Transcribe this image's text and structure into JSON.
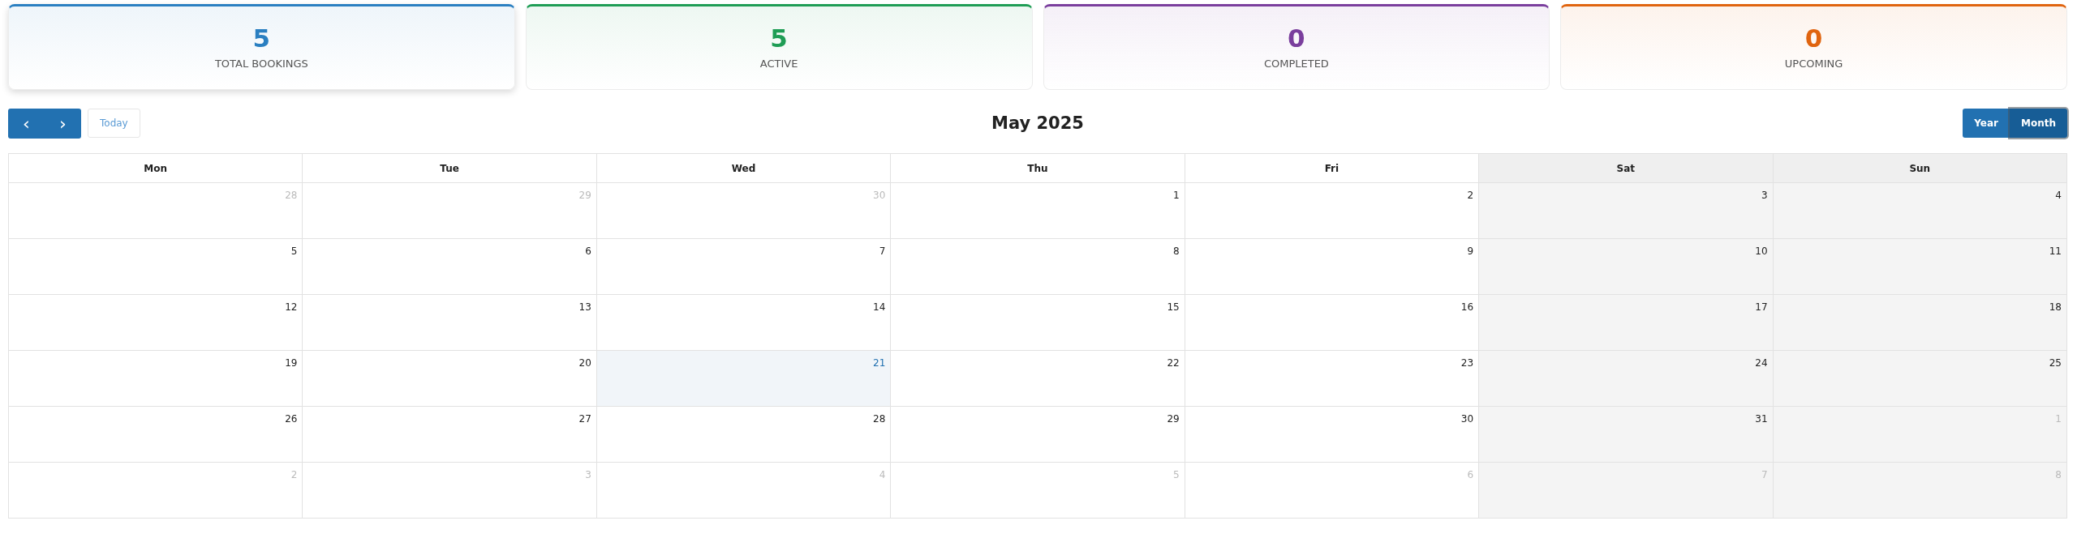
{
  "stats": [
    {
      "value": "5",
      "label": "TOTAL BOOKINGS",
      "color": "#2a7fc1",
      "selected": true
    },
    {
      "value": "5",
      "label": "ACTIVE",
      "color": "#1f9d55",
      "selected": false
    },
    {
      "value": "0",
      "label": "COMPLETED",
      "color": "#7a3e9d",
      "selected": false
    },
    {
      "value": "0",
      "label": "UPCOMING",
      "color": "#e0640f",
      "selected": false
    }
  ],
  "toolbar": {
    "prev": "‹",
    "next": "›",
    "today": "Today",
    "title": "May 2025",
    "views": [
      {
        "label": "Year",
        "selected": false
      },
      {
        "label": "Month",
        "selected": true
      }
    ]
  },
  "calendar": {
    "columns": [
      {
        "label": "Mon",
        "weekend": false
      },
      {
        "label": "Tue",
        "weekend": false
      },
      {
        "label": "Wed",
        "weekend": false
      },
      {
        "label": "Thu",
        "weekend": false
      },
      {
        "label": "Fri",
        "weekend": false
      },
      {
        "label": "Sat",
        "weekend": true
      },
      {
        "label": "Sun",
        "weekend": true
      }
    ],
    "weeks": [
      [
        {
          "day": "28",
          "outside": true,
          "today": false
        },
        {
          "day": "29",
          "outside": true,
          "today": false
        },
        {
          "day": "30",
          "outside": true,
          "today": false
        },
        {
          "day": "1",
          "outside": false,
          "today": false
        },
        {
          "day": "2",
          "outside": false,
          "today": false
        },
        {
          "day": "3",
          "outside": false,
          "today": false
        },
        {
          "day": "4",
          "outside": false,
          "today": false
        }
      ],
      [
        {
          "day": "5",
          "outside": false,
          "today": false
        },
        {
          "day": "6",
          "outside": false,
          "today": false
        },
        {
          "day": "7",
          "outside": false,
          "today": false
        },
        {
          "day": "8",
          "outside": false,
          "today": false
        },
        {
          "day": "9",
          "outside": false,
          "today": false
        },
        {
          "day": "10",
          "outside": false,
          "today": false
        },
        {
          "day": "11",
          "outside": false,
          "today": false
        }
      ],
      [
        {
          "day": "12",
          "outside": false,
          "today": false
        },
        {
          "day": "13",
          "outside": false,
          "today": false
        },
        {
          "day": "14",
          "outside": false,
          "today": false
        },
        {
          "day": "15",
          "outside": false,
          "today": false
        },
        {
          "day": "16",
          "outside": false,
          "today": false
        },
        {
          "day": "17",
          "outside": false,
          "today": false
        },
        {
          "day": "18",
          "outside": false,
          "today": false
        }
      ],
      [
        {
          "day": "19",
          "outside": false,
          "today": false
        },
        {
          "day": "20",
          "outside": false,
          "today": false
        },
        {
          "day": "21",
          "outside": false,
          "today": true
        },
        {
          "day": "22",
          "outside": false,
          "today": false
        },
        {
          "day": "23",
          "outside": false,
          "today": false
        },
        {
          "day": "24",
          "outside": false,
          "today": false
        },
        {
          "day": "25",
          "outside": false,
          "today": false
        }
      ],
      [
        {
          "day": "26",
          "outside": false,
          "today": false
        },
        {
          "day": "27",
          "outside": false,
          "today": false
        },
        {
          "day": "28",
          "outside": false,
          "today": false
        },
        {
          "day": "29",
          "outside": false,
          "today": false
        },
        {
          "day": "30",
          "outside": false,
          "today": false
        },
        {
          "day": "31",
          "outside": false,
          "today": false
        },
        {
          "day": "1",
          "outside": true,
          "today": false
        }
      ],
      [
        {
          "day": "2",
          "outside": true,
          "today": false
        },
        {
          "day": "3",
          "outside": true,
          "today": false
        },
        {
          "day": "4",
          "outside": true,
          "today": false
        },
        {
          "day": "5",
          "outside": true,
          "today": false
        },
        {
          "day": "6",
          "outside": true,
          "today": false
        },
        {
          "day": "7",
          "outside": true,
          "today": false
        },
        {
          "day": "8",
          "outside": true,
          "today": false
        }
      ]
    ]
  }
}
